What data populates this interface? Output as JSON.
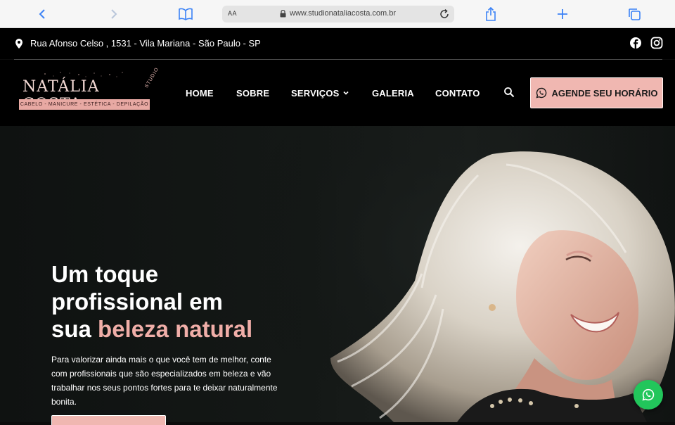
{
  "browser": {
    "aa_label": "AA",
    "url": "www.studionataliacosta.com.br"
  },
  "topbar": {
    "address": "Rua Afonso Celso , 1531 - Vila Mariana - São Paulo - SP"
  },
  "logo": {
    "name": "NATÁLIA COSTA",
    "studio": "STUDIO",
    "tagline": "CABELO - MANICURE - ESTÉTICA - DEPILAÇÃO"
  },
  "nav": {
    "items": [
      "HOME",
      "SOBRE",
      "SERVIÇOS",
      "GALERIA",
      "CONTATO"
    ],
    "cta": "AGENDE SEU HORÁRIO"
  },
  "hero": {
    "title_line1": "Um toque",
    "title_line2": "profissional em",
    "title_line3_prefix": "sua ",
    "title_accent": "beleza natural",
    "paragraph": "Para valorizar ainda mais o que você tem de melhor, conte com profissionais que são especializados em beleza e vão trabalhar nos seus pontos fortes para te deixar naturalmente bonita."
  },
  "colors": {
    "accent_pink": "#f0b7b1",
    "accent_text_pink": "#f0aea8",
    "whatsapp_green": "#22c65b",
    "browser_blue": "#3b82f6"
  },
  "icons": [
    "back-icon",
    "forward-icon",
    "bookmarks-icon",
    "lock-icon",
    "reload-icon",
    "share-icon",
    "new-tab-icon",
    "tabs-icon",
    "location-pin-icon",
    "facebook-icon",
    "instagram-icon",
    "chevron-down-icon",
    "search-icon",
    "whatsapp-icon"
  ]
}
